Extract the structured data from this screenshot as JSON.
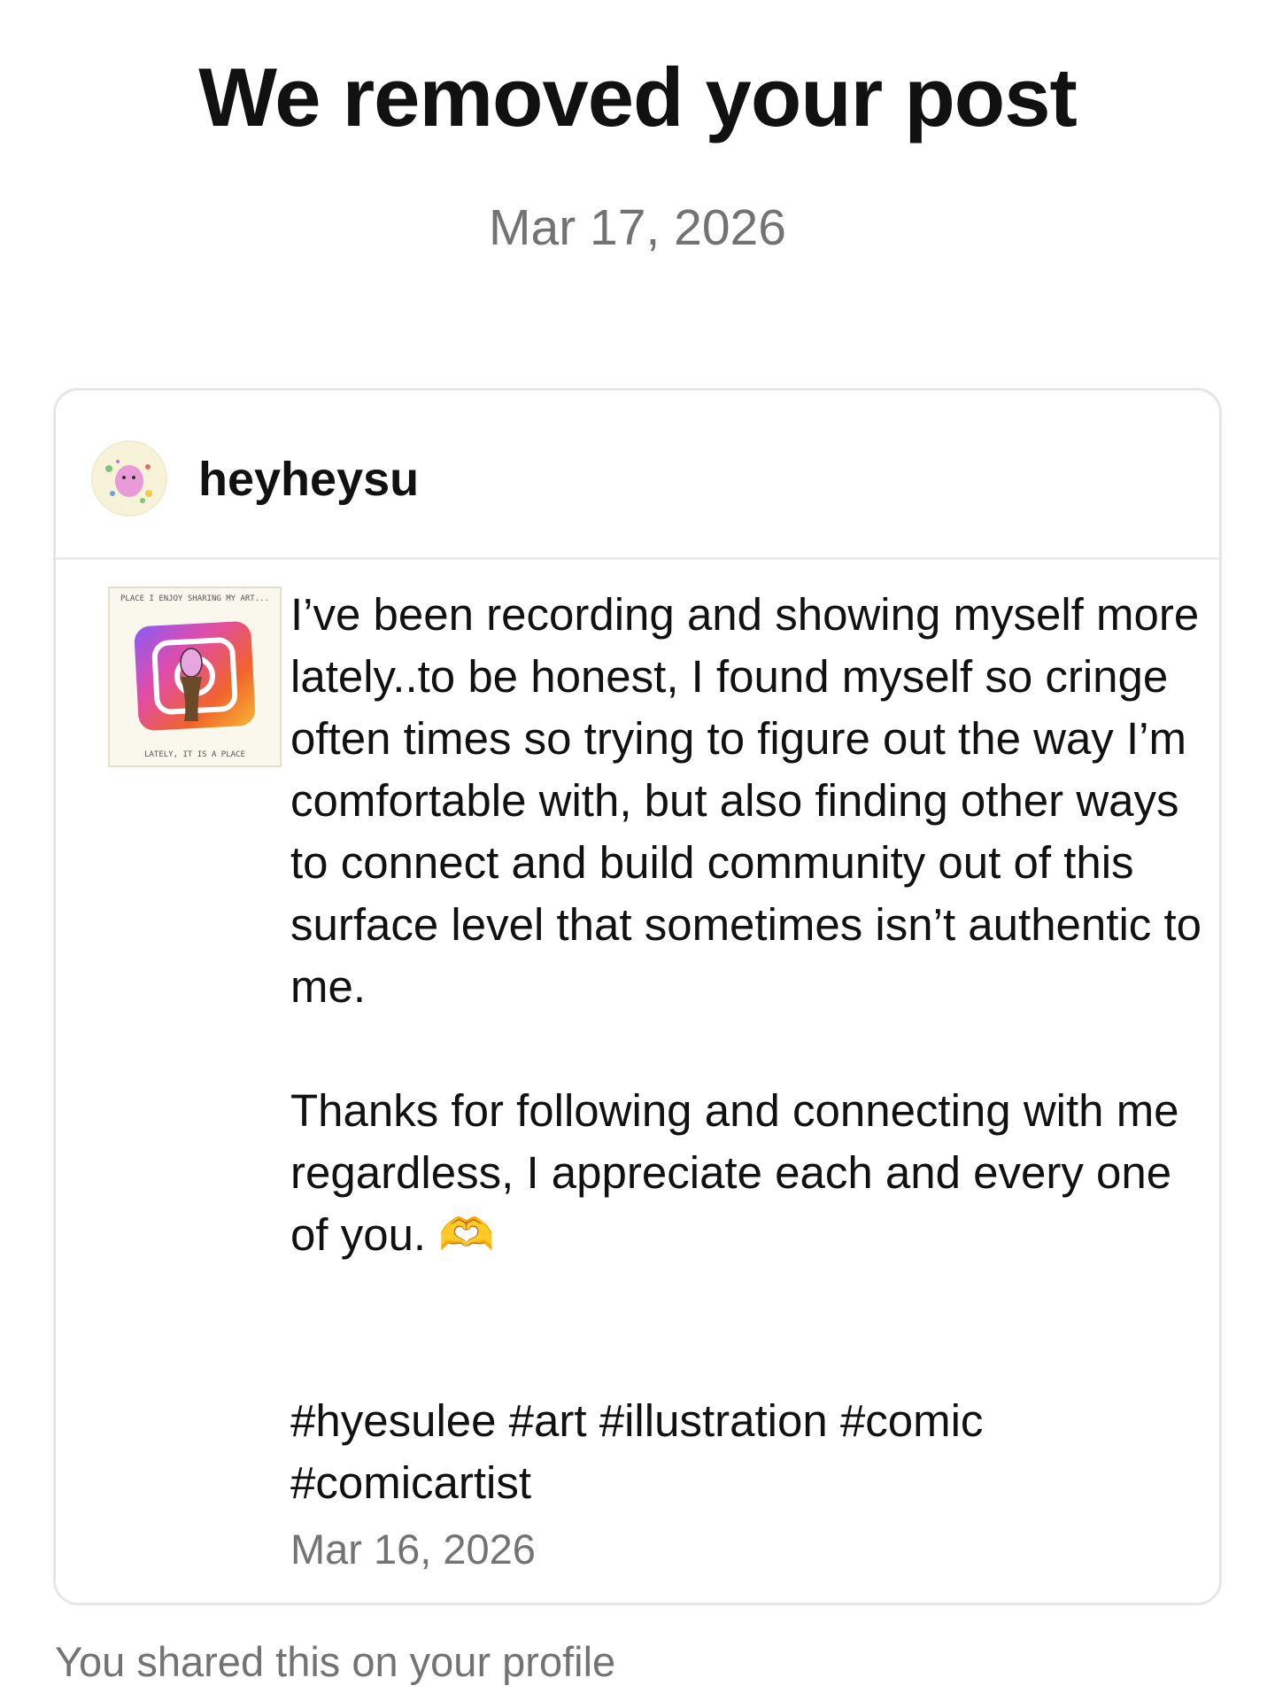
{
  "header": {
    "title": "We removed your post",
    "date": "Mar 17, 2026"
  },
  "post": {
    "username": "heyheysu",
    "avatar_icon": "pink-character-avatar-icon",
    "thumbnail": {
      "top_text": "PLACE I ENJOY SHARING MY ART...",
      "bottom_text": "LATELY, IT IS A PLACE",
      "icon": "instagram-logo-illustration"
    },
    "caption": "I’ve been recording and showing myself more lately..to be honest, I found myself so cringe often times so trying to figure out the way I’m comfortable with, but also finding other ways to connect and build community out of this surface level that sometimes isn’t authentic to me.\n\nThanks for following and connecting with me regardless, I appreciate each and every one of you. 🫶",
    "hashtags": "#hyesulee #art #illustration #comic #comicartist",
    "date": "Mar 16, 2026"
  },
  "footer": {
    "note": "You shared this on your profile"
  },
  "colors": {
    "text": "#111111",
    "muted": "#737373",
    "border": "#e6e6e6"
  }
}
